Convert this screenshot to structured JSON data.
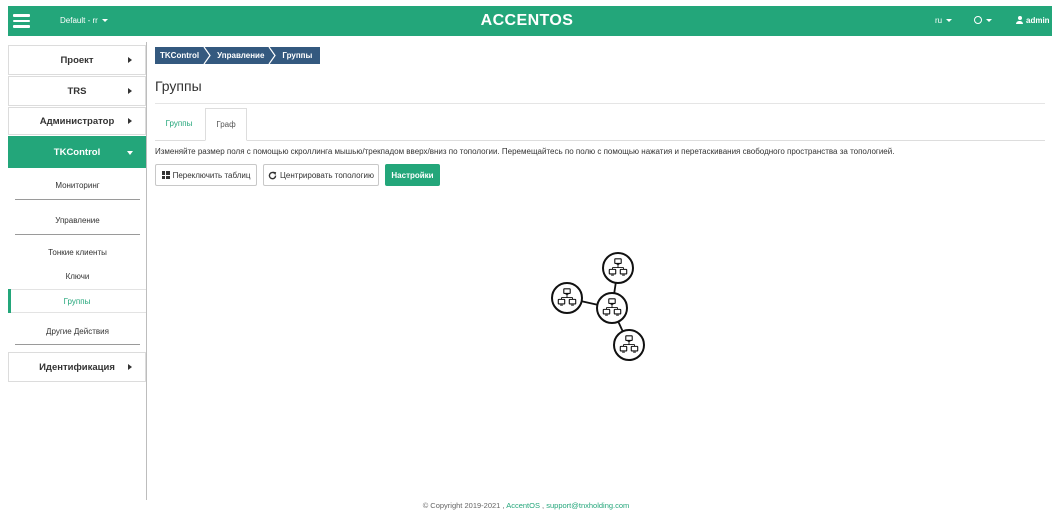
{
  "colors": {
    "accent": "#23a67a",
    "header": "#23a67a",
    "breadcrumb": "#34597f"
  },
  "header": {
    "menu_icon": "hamburger-icon",
    "project_label": "Default - rr",
    "brand": "ACCENTOS",
    "language": "ru",
    "theme_icon": "circle-icon",
    "user_icon": "user-icon",
    "user": "admin"
  },
  "sidebar": {
    "items": [
      {
        "label": "Проект",
        "expanded": false
      },
      {
        "label": "TRS",
        "expanded": false
      },
      {
        "label": "Администратор",
        "expanded": false
      },
      {
        "label": "TKControl",
        "expanded": true,
        "items": [
          {
            "label": "Мониторинг"
          },
          {
            "label": "Управление",
            "items": [
              {
                "label": "Тонкие клиенты"
              },
              {
                "label": "Ключи"
              },
              {
                "label": "Группы",
                "active": true
              }
            ]
          },
          {
            "label": "Другие Действия"
          }
        ]
      },
      {
        "label": "Идентификация",
        "expanded": false
      }
    ]
  },
  "breadcrumb": [
    "TKControl",
    "Управление",
    "Группы"
  ],
  "page_title": "Группы",
  "tabs": [
    {
      "label": "Группы",
      "active": false
    },
    {
      "label": "Граф",
      "active": true
    }
  ],
  "info_text": "Изменяйте размер поля с помощью скроллинга мышью/трекпадом вверх/вниз по топологии. Перемещайтесь по полю с помощью нажатия и перетаскивания свободного пространства за топологией.",
  "toolbar": {
    "toggle_table": {
      "label": "Переключить таблиц",
      "icon": "grid-icon"
    },
    "center_topology": {
      "label": "Центрировать топологию",
      "icon": "refresh-icon"
    },
    "settings": {
      "label": "Настройки"
    }
  },
  "topology": {
    "node_icon": "network-group-icon"
  },
  "footer": {
    "copyright": "© Copyright 2019-2021 ,",
    "brand_link": "AccentOS",
    "separator": ",",
    "support_link": "support@tnxholding.com"
  }
}
